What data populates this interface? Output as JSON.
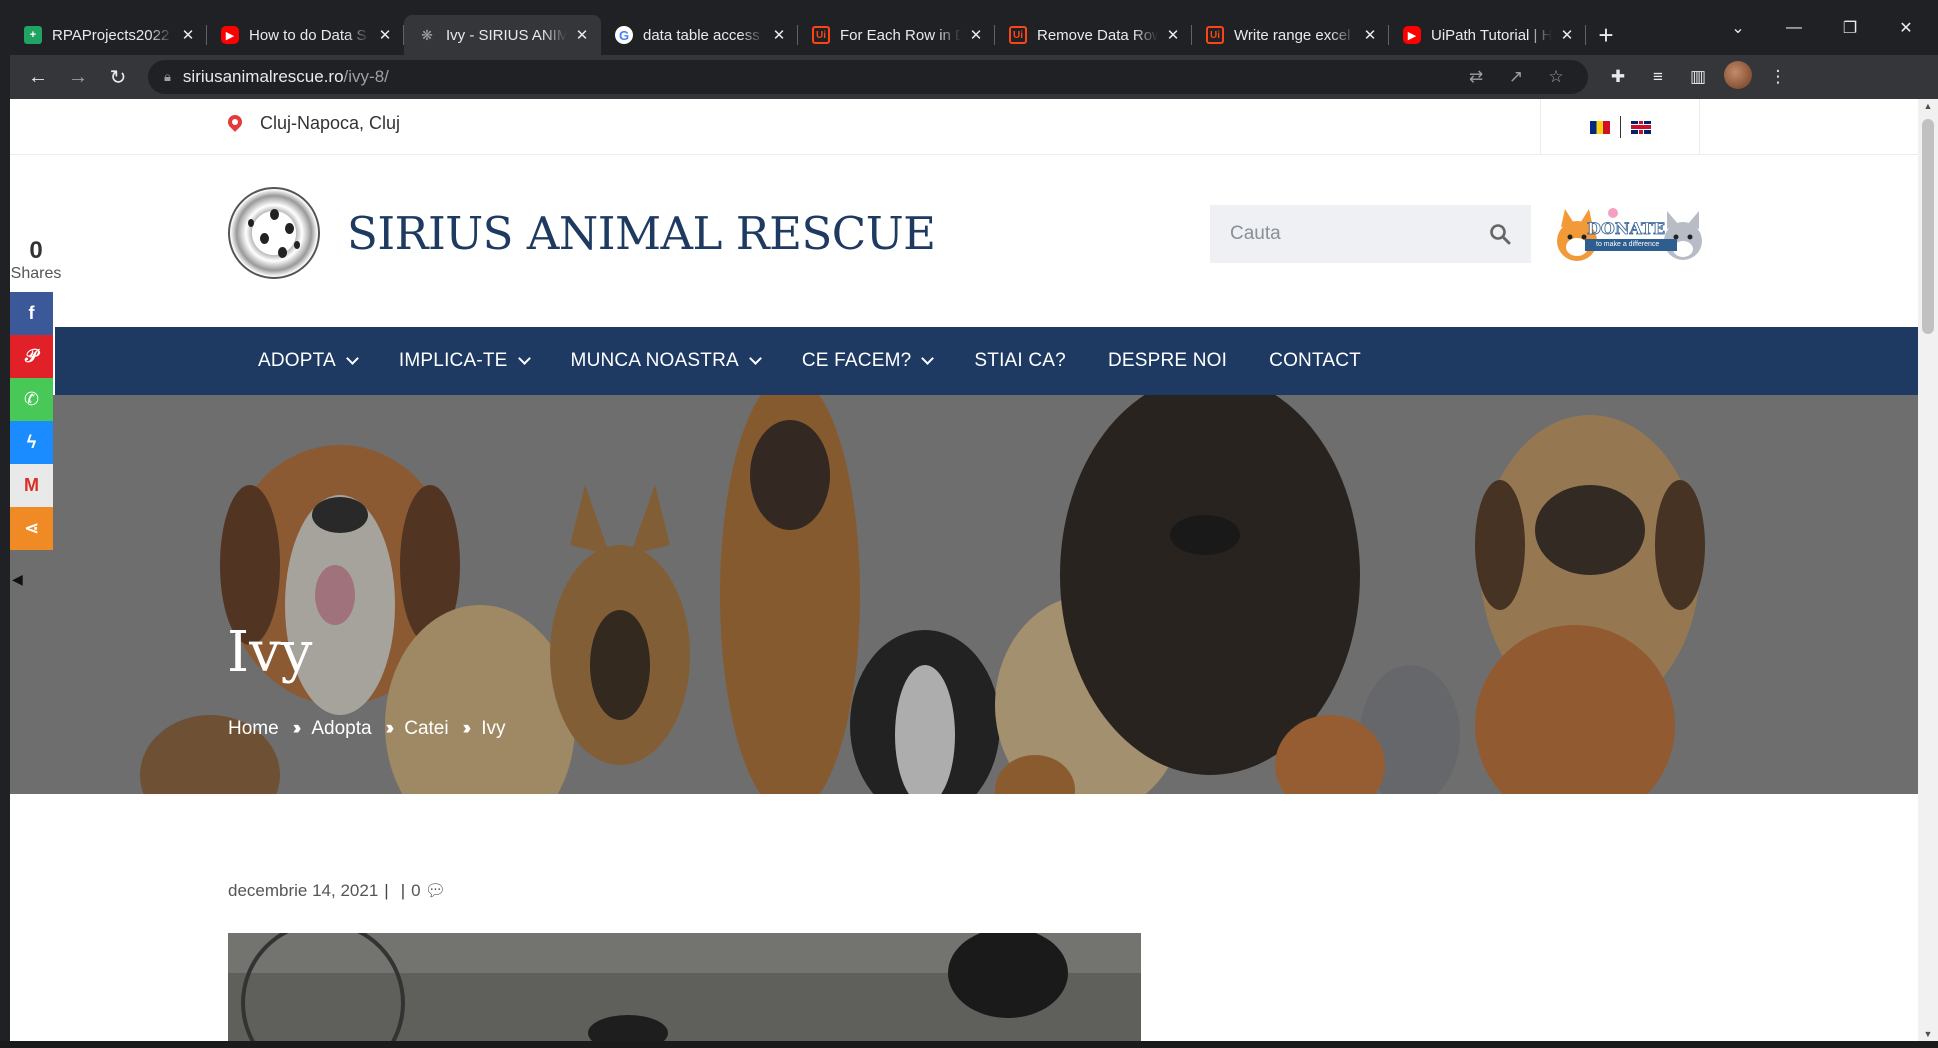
{
  "browser": {
    "tabs": [
      {
        "title": "RPAProjects2022",
        "icon": "sheets-icon",
        "color": "#1fa463",
        "active": false
      },
      {
        "title": "How to do Data S",
        "icon": "youtube-icon",
        "color": "#ff0000",
        "active": false
      },
      {
        "title": "Ivy - SIRIUS ANIM",
        "icon": "paw-icon",
        "color": "#9aa0a6",
        "active": true
      },
      {
        "title": "data table access",
        "icon": "google-icon",
        "color": "#ffffff",
        "active": false
      },
      {
        "title": "For Each Row in D",
        "icon": "uipath-icon",
        "color": "#fa4616",
        "active": false
      },
      {
        "title": "Remove Data Row",
        "icon": "uipath-icon",
        "color": "#fa4616",
        "active": false
      },
      {
        "title": "Write range excel",
        "icon": "uipath-icon",
        "color": "#fa4616",
        "active": false
      },
      {
        "title": "UiPath Tutorial | H",
        "icon": "youtube-icon",
        "color": "#ff0000",
        "active": false
      }
    ],
    "url_host": "siriusanimalrescue.ro",
    "url_path": "/ivy-8/"
  },
  "page": {
    "location": "Cluj-Napoca, Cluj",
    "site_title": "SIRIUS ANIMAL RESCUE",
    "search_placeholder": "Cauta",
    "donate_word": "DONATE",
    "donate_sub": "to make a difference",
    "nav": [
      {
        "label": "ADOPTA",
        "dropdown": true
      },
      {
        "label": "IMPLICA-TE",
        "dropdown": true
      },
      {
        "label": "MUNCA NOASTRA",
        "dropdown": true
      },
      {
        "label": "CE FACEM?",
        "dropdown": true
      },
      {
        "label": "STIAI CA?",
        "dropdown": false
      },
      {
        "label": "DESPRE NOI",
        "dropdown": false
      },
      {
        "label": "CONTACT",
        "dropdown": false
      }
    ],
    "hero_title": "Ivy",
    "breadcrumb": [
      "Home",
      "Adopta",
      "Catei",
      "Ivy"
    ],
    "post_date": "decembrie 14, 2021",
    "comments_count": "0"
  },
  "share": {
    "count": "0",
    "label": "Shares",
    "buttons": [
      {
        "name": "facebook",
        "glyph": "f",
        "color": "#3b5998"
      },
      {
        "name": "pinterest",
        "glyph": "P",
        "color": "#e22027"
      },
      {
        "name": "whatsapp",
        "glyph": "✆",
        "color": "#48c857"
      },
      {
        "name": "messenger",
        "glyph": "✉",
        "color": "#1a8cff"
      },
      {
        "name": "gmail",
        "glyph": "M",
        "color": "#e9e9e9"
      },
      {
        "name": "share",
        "glyph": "<",
        "color": "#f08a24"
      }
    ]
  },
  "colors": {
    "nav_bg": "#1e3a63",
    "title_color": "#1e3a60",
    "browser_dark": "#202124"
  }
}
